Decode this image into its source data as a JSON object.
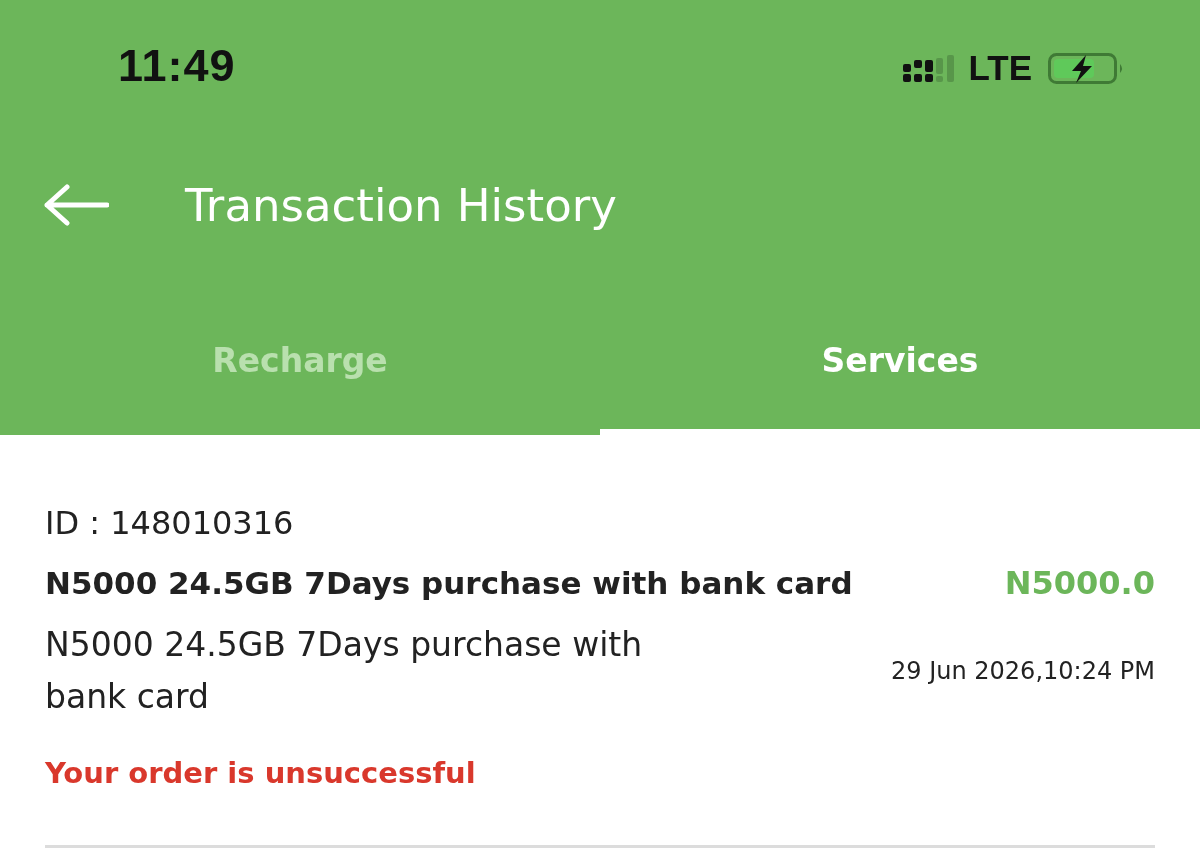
{
  "status_bar": {
    "time": "11:49",
    "network": "LTE"
  },
  "app_bar": {
    "title": "Transaction History"
  },
  "tabs": [
    {
      "label": "Recharge",
      "selected": false
    },
    {
      "label": "Services",
      "selected": true
    }
  ],
  "transactions": [
    {
      "id": "ID : 148010316",
      "title": "N5000 24.5GB 7Days purchase with bank card",
      "amount": "N5000.0",
      "description": "N5000 24.5GB 7Days purchase with bank card",
      "date": "29 Jun 2026,10:24 PM",
      "status": "Your order is unsuccessful",
      "successful": false
    }
  ]
}
